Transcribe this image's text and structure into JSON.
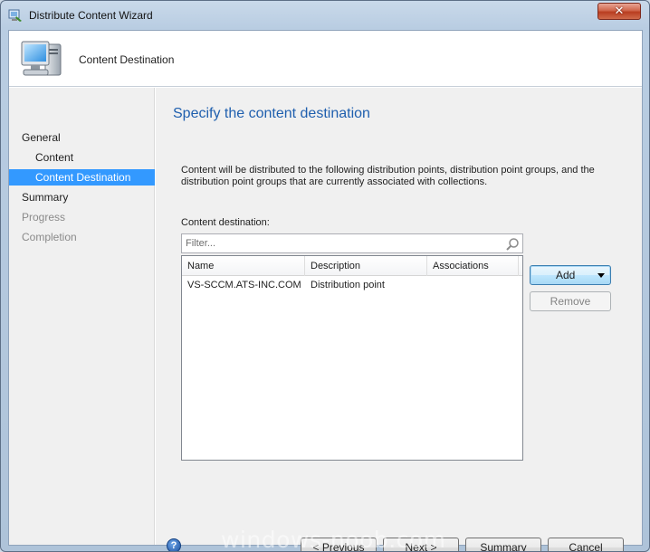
{
  "window": {
    "title": "Distribute Content Wizard",
    "close_label": "✕"
  },
  "header": {
    "title": "Content Destination"
  },
  "sidebar": {
    "items": [
      {
        "label": "General",
        "level": 0,
        "state": "normal"
      },
      {
        "label": "Content",
        "level": 1,
        "state": "normal"
      },
      {
        "label": "Content Destination",
        "level": 1,
        "state": "active"
      },
      {
        "label": "Summary",
        "level": 0,
        "state": "normal"
      },
      {
        "label": "Progress",
        "level": 0,
        "state": "disabled"
      },
      {
        "label": "Completion",
        "level": 0,
        "state": "disabled"
      }
    ]
  },
  "main": {
    "heading": "Specify the content destination",
    "description": "Content will be distributed to the following distribution points, distribution point groups, and the distribution point groups that are currently associated with collections.",
    "field_label": "Content destination:",
    "filter_placeholder": "Filter...",
    "columns": [
      "Name",
      "Description",
      "Associations"
    ],
    "rows": [
      {
        "name": "VS-SCCM.ATS-INC.COM",
        "description": "Distribution point",
        "associations": ""
      }
    ],
    "add_label": "Add",
    "remove_label": "Remove"
  },
  "footer": {
    "help_label": "?",
    "previous_label": "< Previous",
    "next_label": "Next >",
    "summary_label": "Summary",
    "cancel_label": "Cancel"
  },
  "watermark": "windows-noob.com",
  "colors": {
    "accent": "#3399ff",
    "heading": "#1f5fae",
    "close": "#c9462c"
  },
  "icons": [
    "wizard-title-icon",
    "computer-monitor-icon",
    "search-icon",
    "chevron-down-icon",
    "help-icon",
    "close-icon"
  ]
}
